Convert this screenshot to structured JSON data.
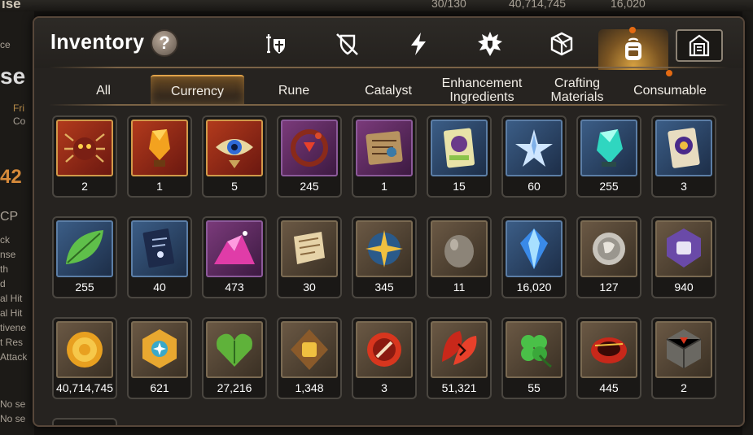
{
  "background": {
    "game_title": "ise",
    "resources": [
      "30/130",
      "40,714,745",
      "16,020"
    ],
    "left_fragments": [
      "ce",
      "se",
      "Fri",
      "Co",
      "42",
      "CP",
      "ck",
      "nse",
      "th",
      "d",
      "al Hit",
      "al Hit",
      "tivene",
      "t Res",
      "Attack",
      "No se",
      "No se"
    ]
  },
  "inventory": {
    "title": "Inventory",
    "help_label": "?"
  },
  "tool_tabs": [
    {
      "id": "equipment",
      "icon": "sword-shield-icon"
    },
    {
      "id": "forbidden",
      "icon": "crossed-shield-icon"
    },
    {
      "id": "boost",
      "icon": "lightning-icon"
    },
    {
      "id": "artifact",
      "icon": "burst-shield-icon"
    },
    {
      "id": "material",
      "icon": "cube-icon"
    },
    {
      "id": "bag",
      "icon": "backpack-icon",
      "active": true,
      "notify": true
    },
    {
      "id": "storage",
      "icon": "storage-gate-icon",
      "notify": true
    }
  ],
  "category_tabs": [
    {
      "label": "All"
    },
    {
      "label": "Currency",
      "active": true
    },
    {
      "label": "Rune"
    },
    {
      "label": "Catalyst"
    },
    {
      "label": "Enhancement\nIngredients"
    },
    {
      "label": "Crafting\nMaterials"
    },
    {
      "label": "Consumable",
      "notify": true
    }
  ],
  "items": [
    {
      "name": "spider-mask",
      "count": "2",
      "frame": "r-red"
    },
    {
      "name": "amber-crystal",
      "count": "1",
      "frame": "r-red"
    },
    {
      "name": "eye-emblem",
      "count": "5",
      "frame": "r-red"
    },
    {
      "name": "red-swirl-charm",
      "count": "245",
      "frame": "r-purple"
    },
    {
      "name": "map-fragment",
      "count": "1",
      "frame": "r-purple"
    },
    {
      "name": "purple-card",
      "count": "15",
      "frame": "r-blue"
    },
    {
      "name": "star-shards",
      "count": "60",
      "frame": "r-blue"
    },
    {
      "name": "teal-crystal",
      "count": "255",
      "frame": "r-blue"
    },
    {
      "name": "purple-scroll-card",
      "count": "3",
      "frame": "r-blue"
    },
    {
      "name": "green-leaf",
      "count": "255",
      "frame": "r-blue"
    },
    {
      "name": "blue-book",
      "count": "40",
      "frame": "r-blue"
    },
    {
      "name": "pink-gem-pile",
      "count": "473",
      "frame": "r-purple"
    },
    {
      "name": "old-scroll",
      "count": "30",
      "frame": "r-brown"
    },
    {
      "name": "compass-star",
      "count": "345",
      "frame": "r-brown"
    },
    {
      "name": "stone-egg",
      "count": "11",
      "frame": "r-brown"
    },
    {
      "name": "crystal-gem",
      "count": "16,020",
      "frame": "r-blue"
    },
    {
      "name": "silver-coin",
      "count": "127",
      "frame": "r-brown"
    },
    {
      "name": "fist-crest",
      "count": "940",
      "frame": "r-brown"
    },
    {
      "name": "gold-coin",
      "count": "40,714,745",
      "frame": "r-brown"
    },
    {
      "name": "gold-medal",
      "count": "621",
      "frame": "r-brown"
    },
    {
      "name": "green-heart",
      "count": "27,216",
      "frame": "r-brown"
    },
    {
      "name": "fist-badge",
      "count": "1,348",
      "frame": "r-brown"
    },
    {
      "name": "red-cap",
      "count": "3",
      "frame": "r-brown"
    },
    {
      "name": "red-leaf-bundle",
      "count": "51,321",
      "frame": "r-brown"
    },
    {
      "name": "clover",
      "count": "55",
      "frame": "r-brown"
    },
    {
      "name": "red-ring",
      "count": "445",
      "frame": "r-brown"
    },
    {
      "name": "stone-dice",
      "count": "2",
      "frame": "r-brown"
    }
  ],
  "colors": {
    "accent": "#e0a24a",
    "panel": "#262320",
    "notify": "#e46a12"
  }
}
